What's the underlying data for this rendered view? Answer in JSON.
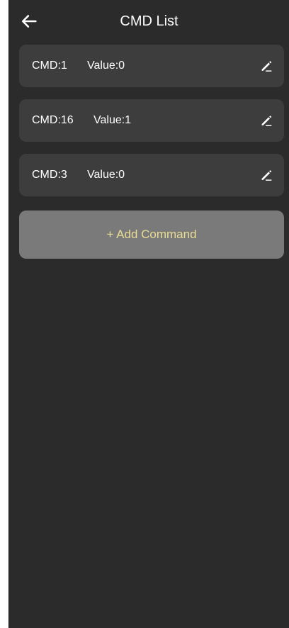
{
  "header": {
    "title": "CMD List",
    "back_icon": "arrow-left-icon"
  },
  "commands": [
    {
      "cmd": "CMD:1",
      "value": "Value:0",
      "edit_icon": "pencil-icon"
    },
    {
      "cmd": "CMD:16",
      "value": "Value:1",
      "edit_icon": "pencil-icon"
    },
    {
      "cmd": "CMD:3",
      "value": "Value:0",
      "edit_icon": "pencil-icon"
    }
  ],
  "add_button": {
    "label": "+ Add Command"
  },
  "colors": {
    "background": "#2b2b2b",
    "card": "#3d3d3d",
    "add_button_bg": "#7a7a7a",
    "add_button_text": "#e9dd96",
    "text": "#ffffff"
  }
}
